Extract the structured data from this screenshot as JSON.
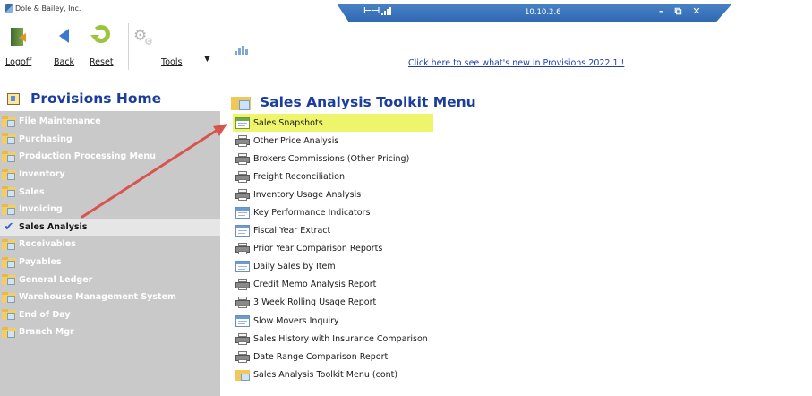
{
  "app": {
    "title": "Dole & Bailey, Inc.",
    "remote_ip": "10.10.2.6"
  },
  "toolbar": {
    "logoff": "Logoff",
    "back": "Back",
    "reset": "Reset",
    "tools": "Tools",
    "news_link": "Click here to see what's new in Provisions 2022.1 !"
  },
  "nav": {
    "title": "Provisions Home",
    "items": [
      {
        "label": "File Maintenance",
        "icon": "folder-icon",
        "active": false
      },
      {
        "label": "Purchasing",
        "icon": "folder-icon",
        "active": false
      },
      {
        "label": "Production Processing Menu",
        "icon": "folder-icon",
        "active": false
      },
      {
        "label": "Inventory",
        "icon": "folder-icon",
        "active": false
      },
      {
        "label": "Sales",
        "icon": "folder-icon",
        "active": false
      },
      {
        "label": "Invoicing",
        "icon": "folder-icon",
        "active": false
      },
      {
        "label": "Sales Analysis",
        "icon": "checkmark-icon",
        "active": true
      },
      {
        "label": "Receivables",
        "icon": "folder-icon",
        "active": false
      },
      {
        "label": "Payables",
        "icon": "folder-icon",
        "active": false
      },
      {
        "label": "General Ledger",
        "icon": "folder-icon",
        "active": false
      },
      {
        "label": "Warehouse Management System",
        "icon": "folder-icon",
        "active": false
      },
      {
        "label": "End of Day",
        "icon": "folder-icon",
        "active": false
      },
      {
        "label": "Branch Mgr",
        "icon": "folder-icon",
        "active": false
      }
    ]
  },
  "main": {
    "title": "Sales Analysis Toolkit Menu",
    "items": [
      {
        "label": "Sales Snapshots",
        "icon": "window-icon",
        "highlight": true
      },
      {
        "label": "Other Price Analysis",
        "icon": "printer-icon",
        "highlight": false
      },
      {
        "label": "Brokers Commissions  (Other Pricing)",
        "icon": "printer-icon",
        "highlight": false
      },
      {
        "label": "Freight Reconciliation",
        "icon": "printer-icon",
        "highlight": false
      },
      {
        "label": "Inventory Usage Analysis",
        "icon": "printer-icon",
        "highlight": false
      },
      {
        "label": "Key Performance Indicators",
        "icon": "window-icon",
        "highlight": false
      },
      {
        "label": "Fiscal Year Extract",
        "icon": "window-icon",
        "highlight": false
      },
      {
        "label": "Prior Year Comparison Reports",
        "icon": "printer-icon",
        "highlight": false
      },
      {
        "label": "Daily Sales by Item",
        "icon": "window-icon",
        "highlight": false
      },
      {
        "label": "Credit Memo Analysis Report",
        "icon": "printer-icon",
        "highlight": false
      },
      {
        "label": "3 Week Rolling Usage Report",
        "icon": "printer-icon",
        "highlight": false
      },
      {
        "label": "Slow Movers Inquiry",
        "icon": "window-icon",
        "highlight": false
      },
      {
        "label": "Sales History with Insurance Comparison",
        "icon": "printer-icon",
        "highlight": false
      },
      {
        "label": "Date Range Comparison Report",
        "icon": "printer-icon",
        "highlight": false
      },
      {
        "label": "Sales Analysis Toolkit Menu (cont)",
        "icon": "folder-icon",
        "highlight": false
      }
    ]
  },
  "colors": {
    "nav_bg": "#c9c9c9",
    "title_blue": "#1b3d9e",
    "highlight": "#eef56a",
    "annotation_arrow": "#d9534f",
    "remote_bar": "#3a74bd"
  }
}
